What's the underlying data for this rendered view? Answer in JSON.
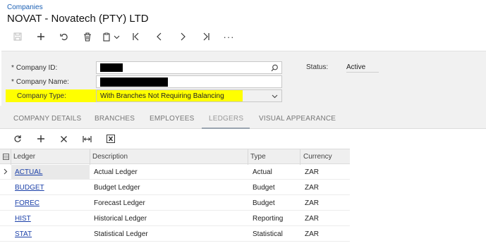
{
  "breadcrumb": "Companies",
  "title": "NOVAT - Novatech (PTY) LTD",
  "toolbar": {
    "icons": [
      "save-icon",
      "add-icon",
      "undo-icon",
      "delete-icon",
      "copy-paste-icon",
      "first-record-icon",
      "previous-record-icon",
      "next-record-icon",
      "last-record-icon",
      "more-icon"
    ],
    "more_label": "···"
  },
  "form": {
    "company_id_label": "Company ID:",
    "company_name_label": "Company Name:",
    "company_type_label": "Company Type:",
    "company_type_value": "With Branches Not Requiring Balancing",
    "required_mark": "*",
    "status_label": "Status:",
    "status_value": "Active"
  },
  "tabs": [
    "COMPANY DETAILS",
    "BRANCHES",
    "EMPLOYEES",
    "LEDGERS",
    "VISUAL APPEARANCE"
  ],
  "active_tab": "LEDGERS",
  "grid": {
    "toolbar_icons": [
      "refresh-icon",
      "add-row-icon",
      "delete-row-icon",
      "fit-columns-icon",
      "export-excel-icon"
    ],
    "columns": [
      "Ledger",
      "Description",
      "Type",
      "Currency"
    ],
    "rows": [
      {
        "ledger": "ACTUAL",
        "description": "Actual Ledger",
        "type": "Actual",
        "currency": "ZAR"
      },
      {
        "ledger": "BUDGET",
        "description": "Budget Ledger",
        "type": "Budget",
        "currency": "ZAR"
      },
      {
        "ledger": "FOREC",
        "description": "Forecast Ledger",
        "type": "Budget",
        "currency": "ZAR"
      },
      {
        "ledger": "HIST",
        "description": "Historical Ledger",
        "type": "Reporting",
        "currency": "ZAR"
      },
      {
        "ledger": "STAT",
        "description": "Statistical Ledger",
        "type": "Statistical",
        "currency": "ZAR"
      }
    ]
  },
  "colors": {
    "link": "#1a3fa8",
    "highlight": "#ffff00",
    "panel_bg": "#f1f1f1"
  }
}
